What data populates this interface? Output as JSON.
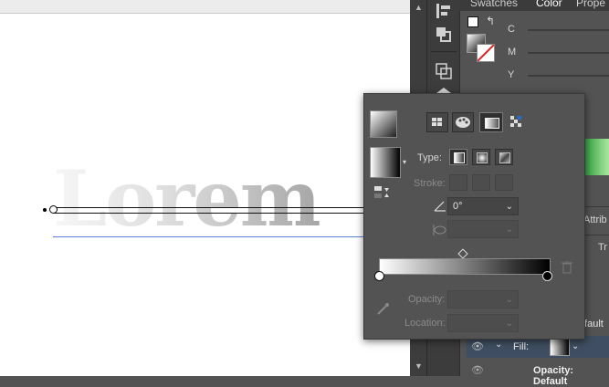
{
  "canvas": {
    "text": "Lorem"
  },
  "right_panel": {
    "tabs": [
      {
        "label": "Swatches"
      },
      {
        "label": "Color"
      },
      {
        "label": "Prope"
      }
    ],
    "color_sliders": [
      {
        "label": "C"
      },
      {
        "label": "M"
      },
      {
        "label": "Y"
      }
    ],
    "side_labels": {
      "attrib": "Attrib",
      "tr": "Tr",
      "default": "Default"
    },
    "fill_row": {
      "label": "Fill:"
    },
    "opacity_row": {
      "label": "Opacity: Default"
    }
  },
  "gradient_panel": {
    "type_label": "Type:",
    "stroke_label": "Stroke:",
    "angle_value": "0°",
    "aspect_value": "",
    "opacity_label": "Opacity:",
    "location_label": "Location:",
    "gradient_stops": [
      {
        "color": "#ffffff",
        "location": 0
      },
      {
        "color": "#000000",
        "location": 100
      }
    ],
    "midpoint": 50
  },
  "colors": {
    "canvas": "#ffffff",
    "panel": "#535353",
    "selection": "#3f4e62",
    "accent_blue": "#1e6fd9"
  }
}
